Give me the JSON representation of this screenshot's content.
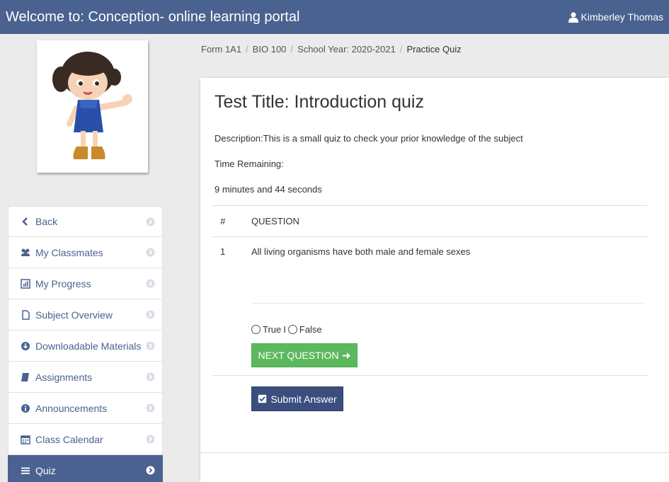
{
  "header": {
    "title": "Welcome to: Conception- online learning portal",
    "user_name": "Kimberley Thomas"
  },
  "breadcrumb": {
    "items": [
      "Form 1A1",
      "BIO 100",
      "School Year: 2020-2021"
    ],
    "current": "Practice Quiz"
  },
  "sidebar": {
    "items": [
      {
        "label": "Back",
        "icon": "chevron-left-icon"
      },
      {
        "label": "My Classmates",
        "icon": "users-icon"
      },
      {
        "label": "My Progress",
        "icon": "bar-chart-icon"
      },
      {
        "label": "Subject Overview",
        "icon": "file-icon"
      },
      {
        "label": "Downloadable Materials",
        "icon": "download-icon"
      },
      {
        "label": "Assignments",
        "icon": "book-icon"
      },
      {
        "label": "Announcements",
        "icon": "info-icon"
      },
      {
        "label": "Class Calendar",
        "icon": "calendar-icon"
      },
      {
        "label": "Quiz",
        "icon": "list-icon",
        "active": true
      }
    ]
  },
  "quiz": {
    "title": "Test Title: Introduction quiz",
    "description": "Description:This is a small quiz to check your prior knowledge of the subject",
    "time_label": "Time Remaining:",
    "time_value": "9 minutes and 44 seconds",
    "table": {
      "headers": [
        "#",
        "QUESTION"
      ],
      "rows": [
        {
          "num": "1",
          "question": "All living organisms have both male and female sexes"
        }
      ]
    },
    "options": {
      "true_label": "True",
      "separator": "I",
      "false_label": "False"
    },
    "next_button": "NEXT QUESTION",
    "submit_button": "Submit Answer"
  },
  "colors": {
    "header_bg": "#4a6290",
    "next_button": "#5cb85c",
    "submit_button": "#3b4f7f",
    "sidebar_text": "#4a6290"
  }
}
